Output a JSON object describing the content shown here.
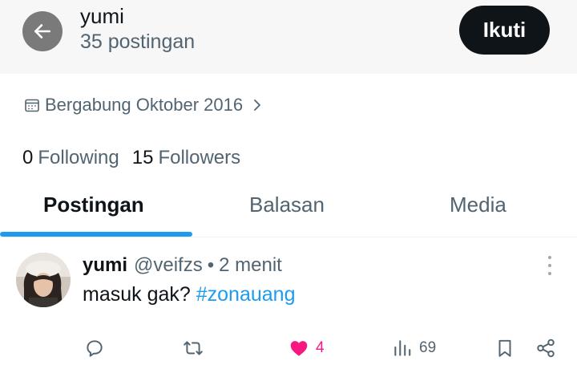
{
  "header": {
    "name": "yumi",
    "post_count": "35 postingan",
    "follow_label": "Ikuti"
  },
  "profile": {
    "joined": "Bergabung Oktober 2016",
    "following_count": "0",
    "following_label": "Following",
    "followers_count": "15",
    "followers_label": "Followers"
  },
  "tabs": [
    {
      "label": "Postingan",
      "active": true
    },
    {
      "label": "Balasan",
      "active": false
    },
    {
      "label": "Media",
      "active": false
    }
  ],
  "tweet": {
    "display_name": "yumi",
    "handle": "@veifzs",
    "separator": "•",
    "time": "2 menit",
    "text": "masuk gak?",
    "hashtag": "#zonauang",
    "actions": {
      "reply_icon": "reply-icon",
      "retweet_icon": "retweet-icon",
      "like_icon": "heart-filled-icon",
      "like_count": "4",
      "views_icon": "views-icon",
      "view_count": "69",
      "bookmark_icon": "bookmark-icon",
      "share_icon": "share-icon"
    }
  },
  "colors": {
    "accent": "#1d9bf0",
    "like": "#f91880",
    "text_primary": "#0f1419",
    "text_secondary": "#536471",
    "follow_button": "#0f1419"
  }
}
